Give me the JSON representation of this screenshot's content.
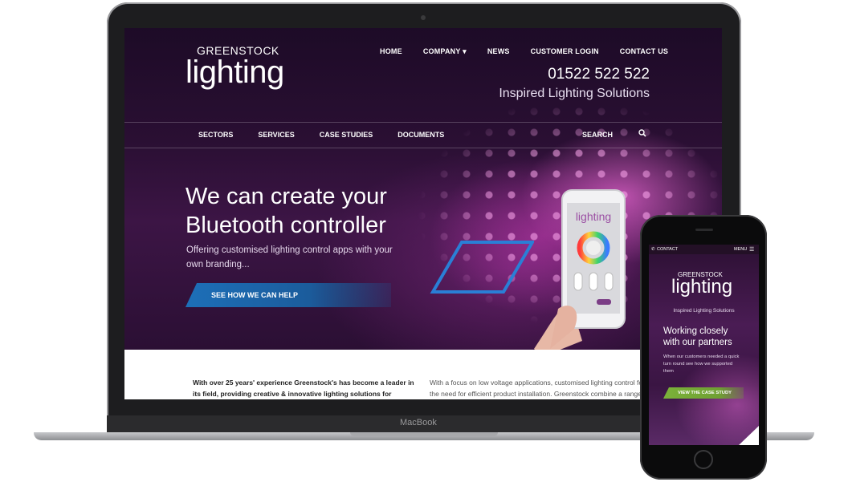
{
  "device": {
    "laptop_label": "MacBook"
  },
  "site": {
    "brand_small": "GREENSTOCK",
    "brand_big": "lighting",
    "phone": "01522 522 522",
    "tagline": "Inspired Lighting Solutions"
  },
  "topnav": [
    "HOME",
    "COMPANY ▾",
    "NEWS",
    "CUSTOMER LOGIN",
    "CONTACT US"
  ],
  "subnav": [
    "SECTORS",
    "SERVICES",
    "CASE STUDIES",
    "DOCUMENTS"
  ],
  "search": {
    "label": "SEARCH"
  },
  "hero": {
    "title_line1": "We can create your",
    "title_line2": "Bluetooth controller",
    "subtitle": "Offering customised lighting control apps with your own branding...",
    "cta": "SEE HOW WE CAN HELP"
  },
  "content": {
    "col1": "With over 25 years' experience Greenstock's has become a leader in its field, providing creative & innovative lighting solutions for specific",
    "col2_line1": "With a focus on low voltage applications, customised lighting control features",
    "col2_line2": "the need for efficient product installation. Greenstock combine a range of off"
  },
  "mobile": {
    "contact": "CONTACT",
    "menu": "MENU",
    "brand_small": "GREENSTOCK",
    "brand_big": "lighting",
    "tagline": "Inspired Lighting Solutions",
    "title_line1": "Working closely",
    "title_line2": "with our partners",
    "subtitle": "When our customers needed a quick turn round see how we supported them",
    "cta": "VIEW THE CASE STUDY"
  },
  "colors": {
    "accent_blue": "#1d6fb8",
    "accent_green": "#7bb23a",
    "purple": "#3c1545"
  }
}
